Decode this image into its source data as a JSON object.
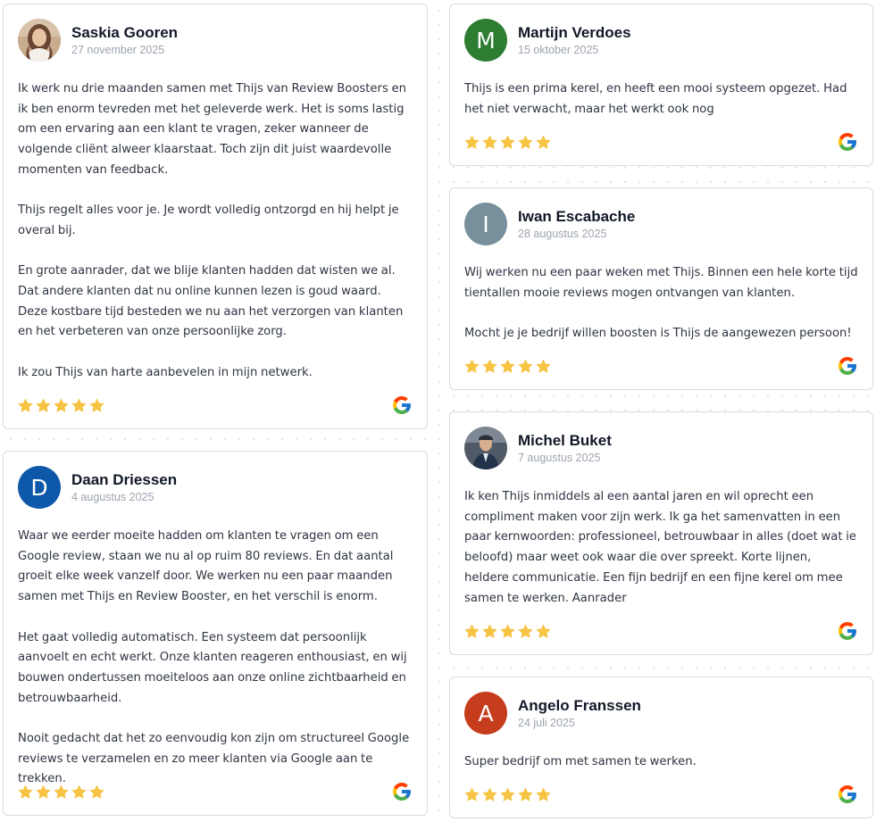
{
  "colors": {
    "star": "#f6c343",
    "card_border": "#d7dbe0",
    "avatar_martijn": "#2e7d32",
    "avatar_iwan": "#78909c",
    "avatar_daan": "#0d58a8",
    "avatar_angelo": "#c63d1e"
  },
  "reviews": [
    {
      "name": "Saskia Gooren",
      "date": "27 november 2025",
      "avatar": "photo",
      "rating": 5,
      "paragraphs": [
        "Ik werk nu drie maanden samen met Thijs van Review Boosters en ik ben enorm tevreden met het geleverde werk. Het is soms lastig om een ervaring aan een klant te vragen, zeker wanneer de volgende cliënt alweer klaarstaat. Toch zijn dit juist waardevolle momenten van feedback.",
        "Thijs regelt alles voor je. Je wordt volledig ontzorgd en hij helpt je overal bij.",
        "En grote aanrader, dat we blije klanten hadden dat wisten we al. Dat andere klanten dat nu online kunnen lezen is goud waard.\nDeze kostbare tijd besteden we nu aan het verzorgen van klanten en het verbeteren van onze persoonlijke zorg.",
        "Ik zou Thijs van harte aanbevelen in mijn netwerk."
      ]
    },
    {
      "name": "Daan Driessen",
      "date": "4 augustus 2025",
      "avatar": "D",
      "rating": 5,
      "paragraphs": [
        "Waar we eerder moeite hadden om klanten te vragen om een Google review, staan we nu al op ruim 80 reviews. En dat aantal groeit elke week vanzelf door. We werken nu een paar maanden samen met Thijs en Review Booster, en het verschil is enorm.",
        "Het gaat volledig automatisch. Een systeem dat persoonlijk aanvoelt en echt werkt. Onze klanten reageren enthousiast, en wij bouwen ondertussen moeiteloos aan onze online zichtbaarheid en betrouwbaarheid.",
        "Nooit gedacht dat het zo eenvoudig kon zijn om structureel Google reviews te verzamelen en zo meer klanten via Google aan te trekken."
      ]
    },
    {
      "name": "Martijn Verdoes",
      "date": "15 oktober 2025",
      "avatar": "M",
      "rating": 5,
      "paragraphs": [
        "Thijs is een prima kerel, en heeft een mooi systeem opgezet. Had het niet verwacht, maar het werkt ook nog"
      ]
    },
    {
      "name": "Iwan Escabache",
      "date": "28 augustus 2025",
      "avatar": "I",
      "rating": 5,
      "paragraphs": [
        "Wij werken nu een paar weken met Thijs. Binnen een hele korte tijd tientallen mooie reviews mogen ontvangen van klanten.",
        "Mocht je je bedrijf willen boosten is Thijs de aangewezen persoon!"
      ]
    },
    {
      "name": "Michel Buket",
      "date": "7 augustus 2025",
      "avatar": "photo",
      "rating": 5,
      "paragraphs": [
        "Ik ken Thijs inmiddels al een aantal jaren en wil oprecht een compliment maken voor zijn werk. Ik ga het samenvatten in een paar kernwoorden: professioneel, betrouwbaar in alles (doet wat ie beloofd) maar weet ook waar die over spreekt. Korte lijnen, heldere communicatie. Een fijn bedrijf en een fijne kerel om mee samen te werken. Aanrader"
      ]
    },
    {
      "name": "Angelo Franssen",
      "date": "24 juli 2025",
      "avatar": "A",
      "rating": 5,
      "paragraphs": [
        "Super bedrijf om met samen te werken."
      ]
    }
  ]
}
